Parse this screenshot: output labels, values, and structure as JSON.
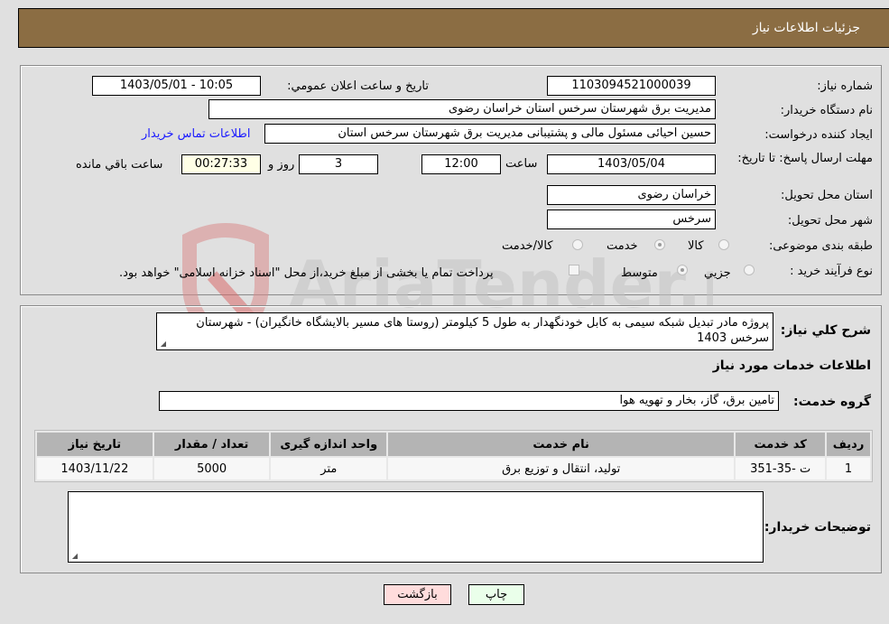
{
  "header": {
    "title": "جزئیات اطلاعات نیاز"
  },
  "details": {
    "need_number_label": "شماره نیاز:",
    "need_number": "1103094521000039",
    "announce_label": "تاریخ و ساعت اعلان عمومي:",
    "announce_value": "1403/05/01 - 10:05",
    "buyer_org_label": "نام دستگاه خريدار:",
    "buyer_org": "مديريت برق شهرستان سرخس استان خراسان رضوی",
    "creator_label": "ايجاد کننده درخواست:",
    "creator": "حسين احيائی مسئول مالی و پشتيبانی مديريت برق شهرستان سرخس استان",
    "contact_link": "اطلاعات تماس خريدار",
    "deadline_label": "مهلت ارسال پاسخ: تا تاريخ:",
    "deadline_date": "1403/05/04",
    "time_label": "ساعت",
    "deadline_time": "12:00",
    "days_value": "3",
    "days_label": "روز و",
    "remaining_time": "00:27:33",
    "remaining_label": "ساعت باقي مانده",
    "province_label": "استان محل تحويل:",
    "province": "خراسان رضوی",
    "city_label": "شهر محل تحويل:",
    "city": "سرخس",
    "category_label": "طبقه بندی موضوعی:",
    "category_options": [
      "کالا",
      "خدمت",
      "کالا/خدمت"
    ],
    "category_selected": "خدمت",
    "process_label": "نوع فرآیند خرید :",
    "process_options": [
      "جزيي",
      "متوسط"
    ],
    "process_selected": "متوسط",
    "treasury_note": "پرداخت تمام يا بخشی از مبلغ خريد،از محل \"اسناد خزانه اسلامی\" خواهد بود."
  },
  "description": {
    "label": "شرح كلي نياز:",
    "text": "پروژه مادر تبدیل شبکه سیمی به کابل خودنگهدار به طول 5 کیلومتر (روستا های مسیر بالایشگاه خانگیران) - شهرستان سرخس 1403"
  },
  "services": {
    "section_title": "اطلاعات خدمات مورد نياز",
    "group_label": "گروه خدمت:",
    "group_value": "تامين برق، گاز، بخار و تهويه هوا",
    "columns": [
      "رديف",
      "کد خدمت",
      "نام خدمت",
      "واحد اندازه گيری",
      "تعداد / مقدار",
      "تاريخ نياز"
    ],
    "rows": [
      [
        "1",
        "ت -35-351",
        "توليد، انتقال و توزيع برق",
        "متر",
        "5000",
        "1403/11/22"
      ]
    ]
  },
  "buyer_notes": {
    "label": "توضيحات خريدار:",
    "value": ""
  },
  "actions": {
    "print": "چاپ",
    "back": "بازگشت"
  },
  "watermark": {
    "text": "AriaTender.neT"
  },
  "colors": {
    "header_bg": "#8b6d43",
    "print_bg": "#eaffea",
    "back_bg": "#ffdcdc",
    "link": "#1a1aff",
    "remaining_bg": "#ffffe6"
  }
}
